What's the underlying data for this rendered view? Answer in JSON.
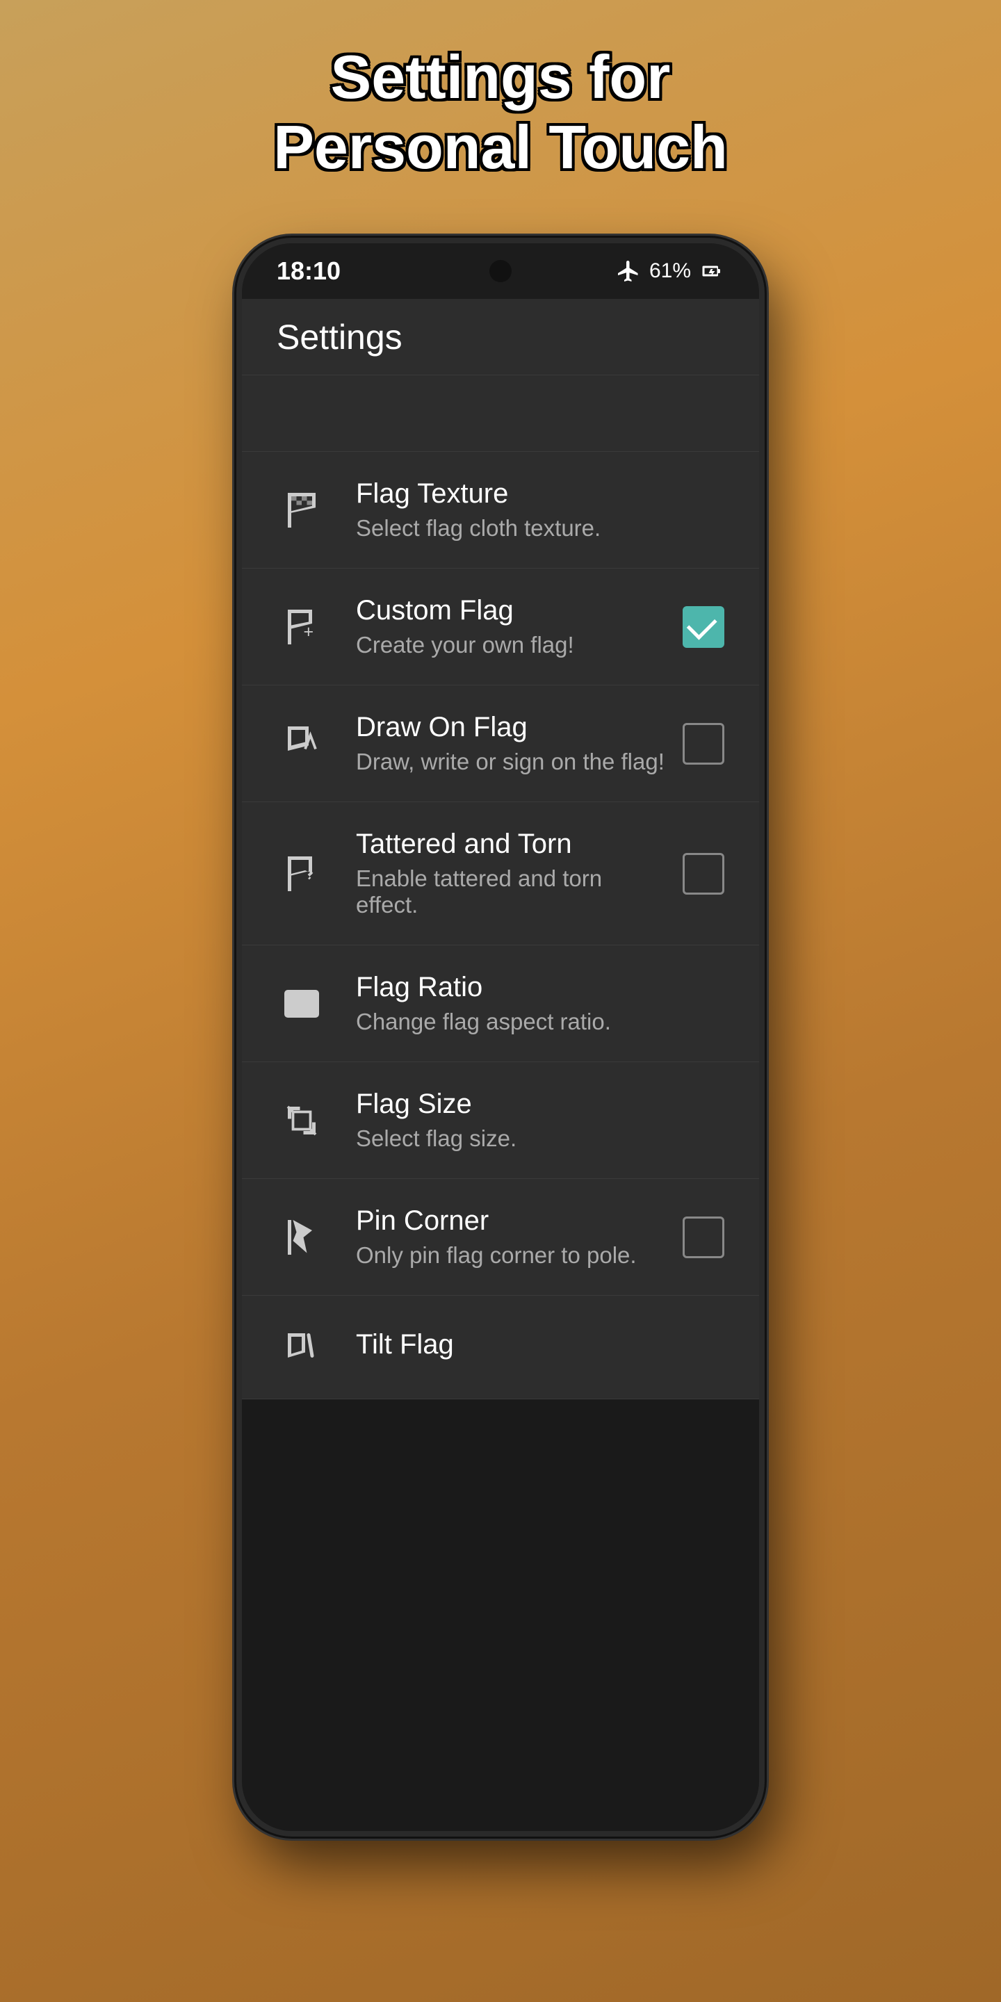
{
  "page": {
    "title_line1": "Settings for",
    "title_line2": "Personal Touch"
  },
  "status_bar": {
    "time": "18:10",
    "battery": "61%"
  },
  "app_bar": {
    "title": "Settings"
  },
  "settings": {
    "items": [
      {
        "id": "flag-texture",
        "title": "Flag Texture",
        "subtitle": "Select flag cloth texture.",
        "has_checkbox": false,
        "checked": false,
        "icon": "flag-texture-icon"
      },
      {
        "id": "custom-flag",
        "title": "Custom Flag",
        "subtitle": "Create your own flag!",
        "has_checkbox": true,
        "checked": true,
        "icon": "custom-flag-icon"
      },
      {
        "id": "draw-on-flag",
        "title": "Draw On Flag",
        "subtitle": "Draw, write or sign on the flag!",
        "has_checkbox": true,
        "checked": false,
        "icon": "draw-flag-icon"
      },
      {
        "id": "tattered-torn",
        "title": "Tattered and Torn",
        "subtitle": "Enable tattered and torn effect.",
        "has_checkbox": true,
        "checked": false,
        "icon": "tattered-icon"
      },
      {
        "id": "flag-ratio",
        "title": "Flag Ratio",
        "subtitle": "Change flag aspect ratio.",
        "has_checkbox": false,
        "checked": false,
        "icon": "ratio-icon"
      },
      {
        "id": "flag-size",
        "title": "Flag Size",
        "subtitle": "Select flag size.",
        "has_checkbox": false,
        "checked": false,
        "icon": "size-icon"
      },
      {
        "id": "pin-corner",
        "title": "Pin Corner",
        "subtitle": "Only pin flag corner to pole.",
        "has_checkbox": true,
        "checked": false,
        "icon": "pin-icon"
      },
      {
        "id": "tilt-flag",
        "title": "Tilt Flag",
        "subtitle": "",
        "has_checkbox": false,
        "checked": false,
        "icon": "tilt-icon"
      }
    ]
  }
}
